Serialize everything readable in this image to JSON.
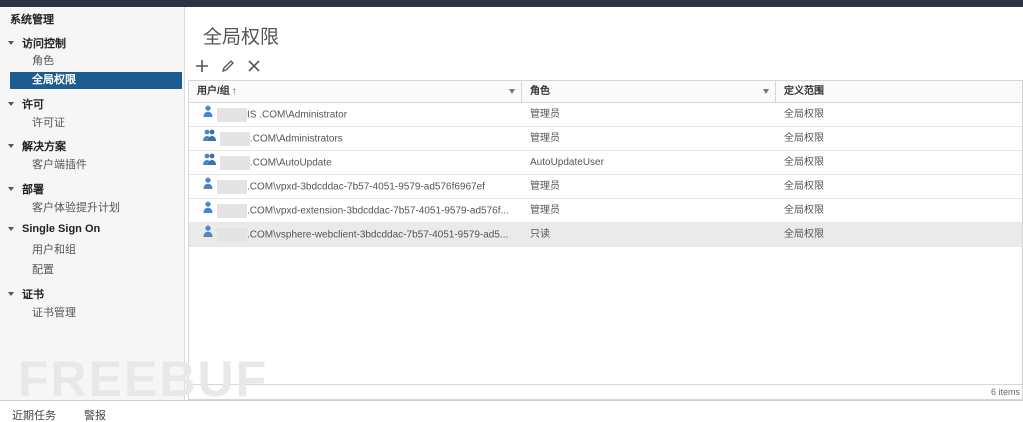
{
  "sidebar": {
    "root": "系统管理",
    "groups": {
      "access": "访问控制",
      "license": "许可",
      "solutions": "解决方案",
      "deploy": "部署",
      "sso": "Single Sign On",
      "cert": "证书"
    },
    "items": {
      "roles": "角色",
      "global_permissions": "全局权限",
      "licenses": "许可证",
      "client_plugins": "客户端插件",
      "ceip": "客户体验提升计划",
      "users_groups": "用户和组",
      "config": "配置",
      "cert_mgmt": "证书管理"
    }
  },
  "main": {
    "title": "全局权限",
    "toolbar": {
      "add": "+",
      "edit": "✎",
      "delete": "✕"
    },
    "columns": {
      "user": "用户/组",
      "sort": "↑",
      "role": "角色",
      "scope": "定义范围"
    },
    "rows": [
      {
        "user": "IS  .COM\\Administrator",
        "role": "管理员",
        "scope": "全局权限",
        "icon": "user-icon"
      },
      {
        "user": ".COM\\Administrators",
        "role": "管理员",
        "scope": "全局权限",
        "icon": "group-icon"
      },
      {
        "user": ".COM\\AutoUpdate",
        "role": "AutoUpdateUser",
        "scope": "全局权限",
        "icon": "group-icon"
      },
      {
        "user": ".COM\\vpxd-3bdcddac-7b57-4051-9579-ad576f6967ef",
        "role": "管理员",
        "scope": "全局权限",
        "icon": "user-icon"
      },
      {
        "user": ".COM\\vpxd-extension-3bdcddac-7b57-4051-9579-ad576f...",
        "role": "管理员",
        "scope": "全局权限",
        "icon": "user-icon"
      },
      {
        "user": ".COM\\vsphere-webclient-3bdcddac-7b57-4051-9579-ad5...",
        "role": "只读",
        "scope": "全局权限",
        "icon": "user-icon"
      }
    ],
    "item_count": "6 items"
  },
  "bottom": {
    "recent_tasks": "近期任务",
    "alarms": "警报"
  },
  "watermark": "FREEBUF",
  "colors": {
    "selected_nav": "#1d5c91",
    "topbar": "#2b3541",
    "sort_arrow": "#1f6eb5"
  }
}
